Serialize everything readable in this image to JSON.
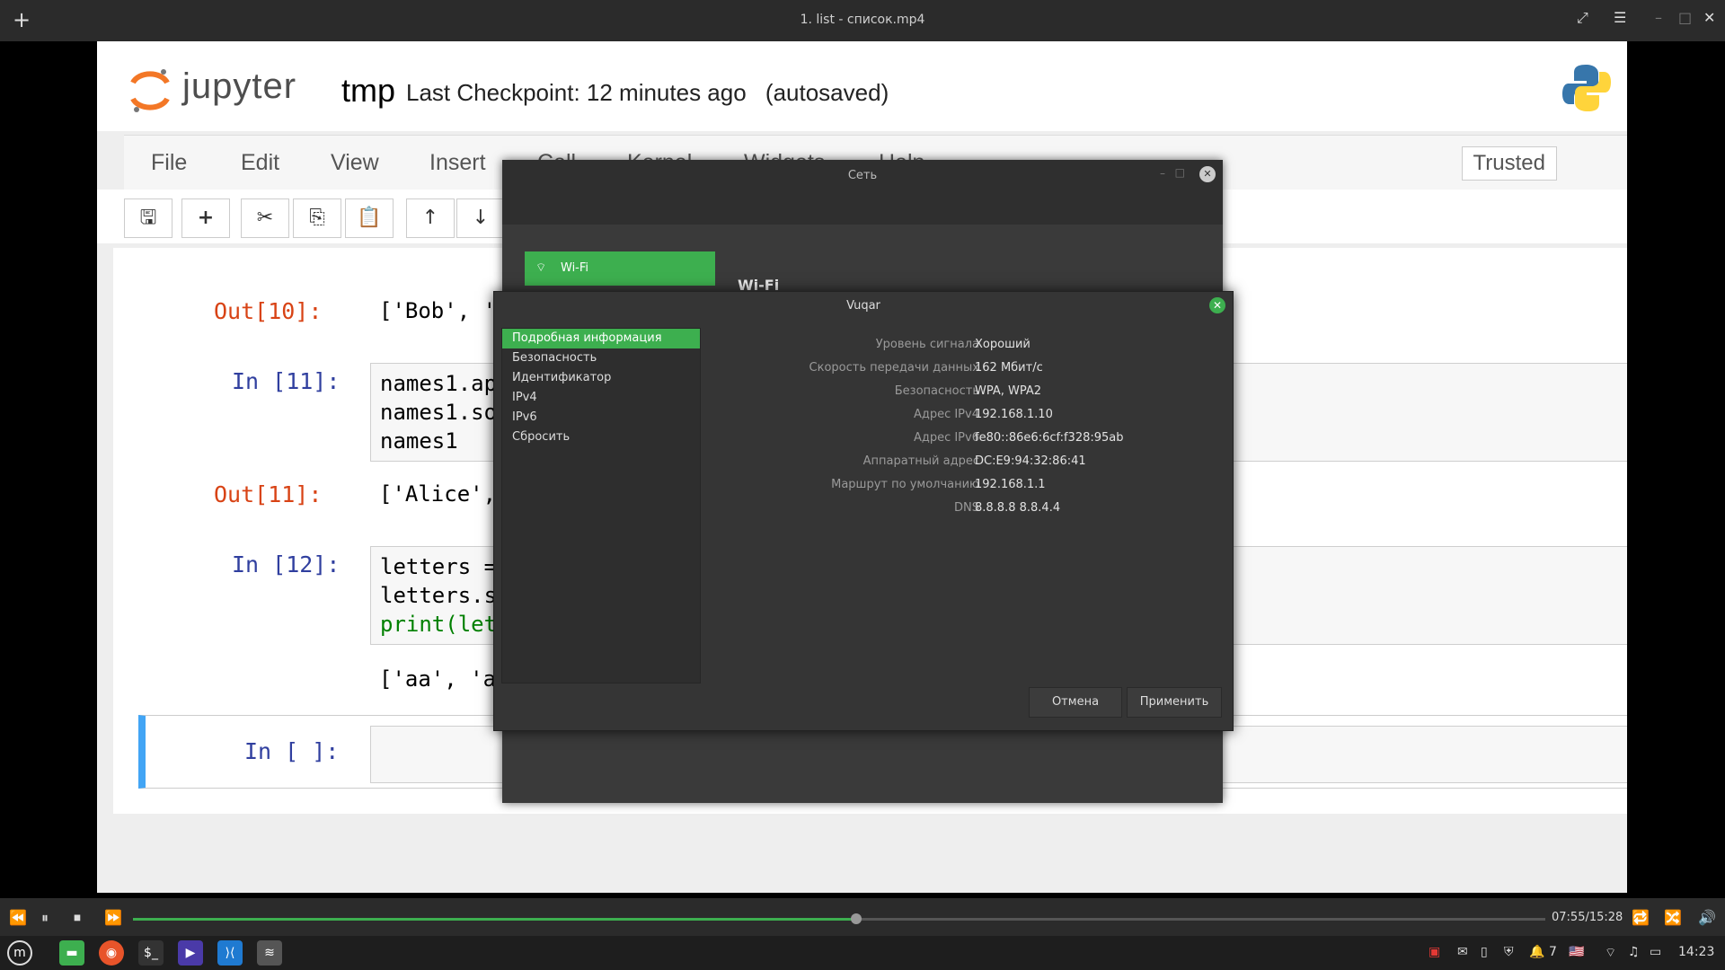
{
  "player": {
    "title": "1. list - список.mp4",
    "timecode": "07:55/15:28",
    "progress": 0.512
  },
  "jupyter": {
    "logo_text": "jupyter",
    "notebook_name": "tmp",
    "checkpoint": "Last Checkpoint: 12 minutes ago",
    "autosaved": "(autosaved)",
    "menu": [
      "File",
      "Edit",
      "View",
      "Insert",
      "Cell",
      "Kernel",
      "Widgets",
      "Help"
    ],
    "trusted": "Trusted",
    "cells": {
      "out10_prompt": "Out[10]:",
      "out10_text": "['Bob', 'Alic",
      "in11_prompt": "In [11]:",
      "in11_lines": [
        "names1.appen",
        "names1.sort(",
        "names1"
      ],
      "out11_prompt": "Out[11]:",
      "out11_text": "['Alice', 'B",
      "in12_prompt": "In [12]:",
      "in12_lines": [
        "letters = ['",
        "letters.sort",
        "print(letter"
      ],
      "out12_text": "['aa', 'ab',",
      "in_empty_prompt": "In [ ]:"
    }
  },
  "network_window": {
    "title": "Сеть",
    "wifi_tab": "Wi-Fi",
    "wifi_heading": "Wi-Fi"
  },
  "dialog": {
    "title": "Vuqar",
    "sidebar": [
      "Подробная информация",
      "Безопасность",
      "Идентификатор",
      "IPv4",
      "IPv6",
      "Сбросить"
    ],
    "details": [
      {
        "label": "Уровень сигнала",
        "value": "Хороший"
      },
      {
        "label": "Скорость передачи данных",
        "value": "162 Мбит/с"
      },
      {
        "label": "Безопасность",
        "value": "WPA, WPA2"
      },
      {
        "label": "Адрес IPv4",
        "value": "192.168.1.10"
      },
      {
        "label": "Адрес IPv6",
        "value": "fe80::86e6:6cf:f328:95ab"
      },
      {
        "label": "Аппаратный адрес",
        "value": "DC:E9:94:32:86:41"
      },
      {
        "label": "Маршрут по умолчанию",
        "value": "192.168.1.1"
      },
      {
        "label": "DNS",
        "value": "8.8.8.8 8.8.4.4"
      }
    ],
    "cancel": "Отмена",
    "apply": "Применить"
  },
  "taskbar": {
    "clock": "14:23",
    "notif_count": "7"
  },
  "colors": {
    "accent_green": "#3daf4f",
    "jupyter_orange": "#f37726",
    "in_prompt": "#303f9f",
    "out_prompt": "#d84315"
  }
}
